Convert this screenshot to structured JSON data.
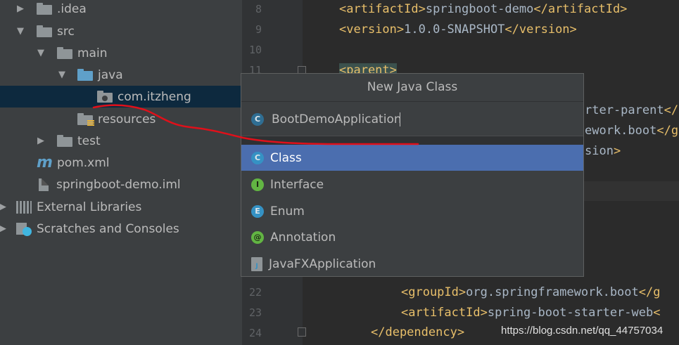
{
  "project_tree": {
    "items": [
      {
        "label": ".idea",
        "arrow": "▶"
      },
      {
        "label": "src",
        "arrow": "▼"
      },
      {
        "label": "main",
        "arrow": "▼"
      },
      {
        "label": "java",
        "arrow": "▼"
      },
      {
        "label": "com.itzheng",
        "arrow": ""
      },
      {
        "label": "resources",
        "arrow": ""
      },
      {
        "label": "test",
        "arrow": "▶"
      },
      {
        "label": "pom.xml",
        "arrow": ""
      },
      {
        "label": "springboot-demo.iml",
        "arrow": ""
      },
      {
        "label": "External Libraries",
        "arrow": "▶"
      },
      {
        "label": "Scratches and Consoles",
        "arrow": "▶"
      }
    ],
    "pom_icon": "m"
  },
  "editor": {
    "line_numbers": [
      "8",
      "9",
      "10",
      "11",
      "22",
      "23",
      "24"
    ],
    "lines": {
      "l8": {
        "open": "<artifactId>",
        "text": "springboot-demo",
        "close": "</artifactId>"
      },
      "l9": {
        "open": "<version>",
        "text": "1.0.0-SNAPSHOT",
        "close": "</version>"
      },
      "l11": {
        "open": "<parent>"
      },
      "peek1": "rter-parent",
      "peek1_tag": "</",
      "peek2": "ework.boot",
      "peek2_tag": "</g",
      "peek3": "sion",
      "peek3_tag": ">",
      "l22": {
        "open": "<groupId>",
        "text": "org.springframework.boot",
        "close": "</g"
      },
      "l23": {
        "open": "<artifactId>",
        "text": "spring-boot-starter-web",
        "close": "<"
      },
      "l24": {
        "close": "</dependency>"
      }
    },
    "watermark": "https://blog.csdn.net/qq_44757034"
  },
  "popup": {
    "title": "New Java Class",
    "name_value": "BootDemoApplication",
    "name_badge": "C",
    "kinds": [
      {
        "label": "Class",
        "badge": "C"
      },
      {
        "label": "Interface",
        "badge": "I"
      },
      {
        "label": "Enum",
        "badge": "E"
      },
      {
        "label": "Annotation",
        "badge": "@"
      },
      {
        "label": "JavaFXApplication",
        "badge": "J"
      }
    ]
  },
  "colors": {
    "selected_row": "#4b6eaf",
    "tree_selection": "#0d293e",
    "annotation_red": "#e0101a"
  }
}
